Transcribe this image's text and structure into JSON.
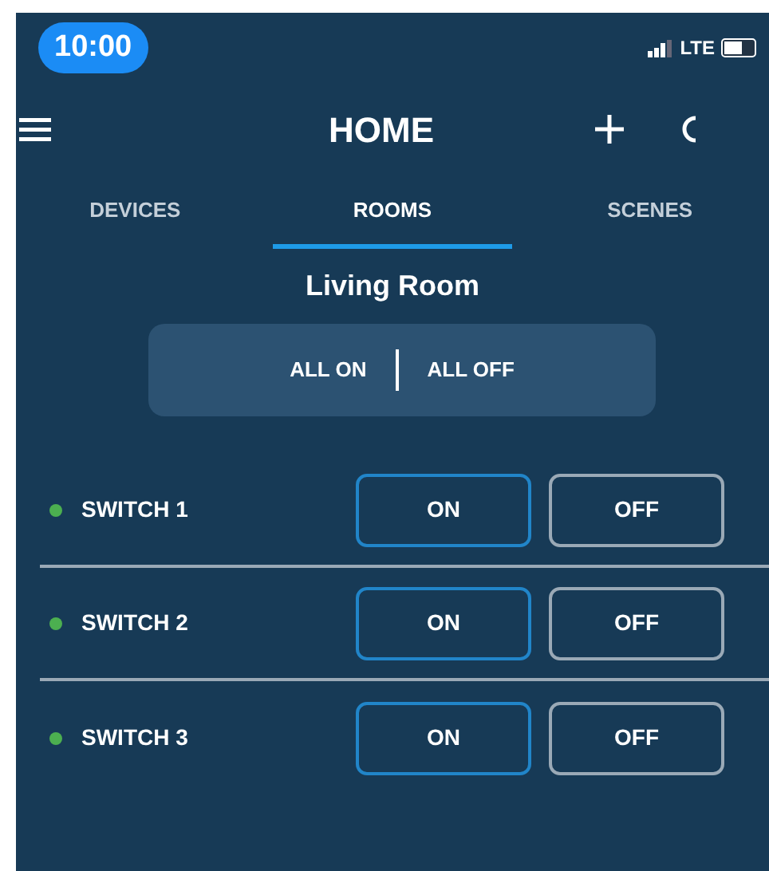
{
  "status_bar": {
    "time": "10:00",
    "network": "LTE"
  },
  "header": {
    "title": "HOME"
  },
  "tabs": [
    {
      "label": "DEVICES",
      "selected": false
    },
    {
      "label": "ROOMS",
      "selected": true
    },
    {
      "label": "SCENES",
      "selected": false
    }
  ],
  "room": {
    "title": "Living Room",
    "all_on": "ALL ON",
    "all_off": "ALL OFF"
  },
  "switches": [
    {
      "name": "SWITCH 1",
      "online": true,
      "on": true,
      "on_label": "ON",
      "off_label": "OFF"
    },
    {
      "name": "SWITCH 2",
      "online": true,
      "on": true,
      "on_label": "ON",
      "off_label": "OFF"
    },
    {
      "name": "SWITCH 3",
      "online": true,
      "on": true,
      "on_label": "ON",
      "off_label": "OFF"
    }
  ]
}
